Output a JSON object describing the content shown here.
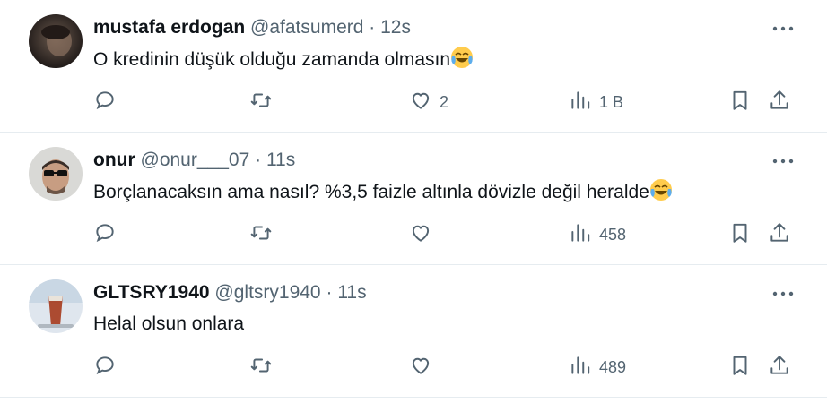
{
  "tweets": [
    {
      "name": "mustafa erdogan",
      "handle": "@afatsumerd",
      "dot": "·",
      "time": "12s",
      "text": "O kredinin düşük olduğu zamanda olmasın",
      "emoji": "face-with-tears-of-joy",
      "actions": {
        "replies": "",
        "retweets": "",
        "likes": "2",
        "views": "1 B"
      }
    },
    {
      "name": "onur",
      "handle": "@onur___07",
      "dot": "·",
      "time": "11s",
      "text": "Borçlanacaksın ama nasıl? %3,5 faizle altınla dövizle değil heralde",
      "emoji": "face-with-tears-of-joy",
      "actions": {
        "replies": "",
        "retweets": "",
        "likes": "",
        "views": "458"
      }
    },
    {
      "name": "GLTSRY1940",
      "handle": "@gltsry1940",
      "dot": "·",
      "time": "11s",
      "text": "Helal olsun onlara",
      "emoji": "",
      "actions": {
        "replies": "",
        "retweets": "",
        "likes": "",
        "views": "489"
      }
    }
  ],
  "colors": {
    "text": "#0f1419",
    "secondary": "#536471",
    "divider": "#e6ecf0"
  },
  "icons": [
    "reply-icon",
    "retweet-icon",
    "like-icon",
    "views-icon",
    "bookmark-icon",
    "share-icon",
    "more-icon"
  ]
}
